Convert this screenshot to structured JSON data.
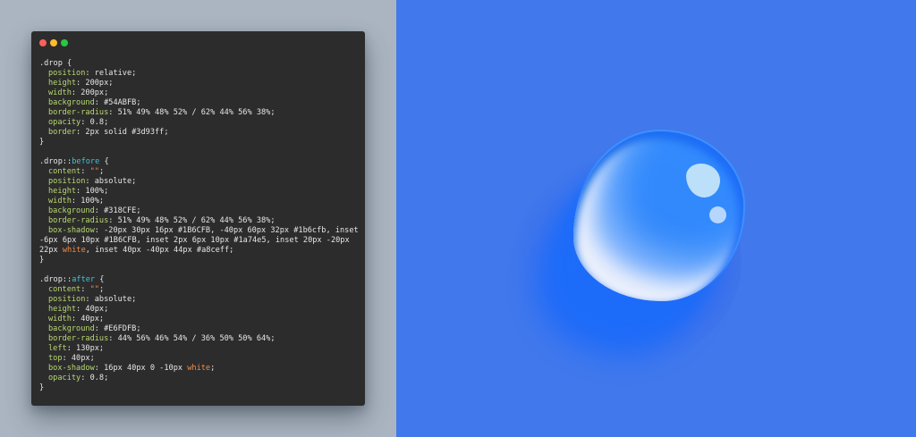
{
  "window": {
    "controls": [
      "close",
      "minimize",
      "zoom"
    ]
  },
  "code": {
    "lines": [
      [
        {
          "t": ".drop {"
        }
      ],
      [
        {
          "ind": 1
        },
        {
          "t": "position",
          "c": "p"
        },
        {
          "t": ": relative;"
        }
      ],
      [
        {
          "ind": 1
        },
        {
          "t": "height",
          "c": "p"
        },
        {
          "t": ": 200px;"
        }
      ],
      [
        {
          "ind": 1
        },
        {
          "t": "width",
          "c": "p"
        },
        {
          "t": ": 200px;"
        }
      ],
      [
        {
          "ind": 1
        },
        {
          "t": "background",
          "c": "p"
        },
        {
          "t": ": #54ABFB;"
        }
      ],
      [
        {
          "ind": 1
        },
        {
          "t": "border-radius",
          "c": "p"
        },
        {
          "t": ": 51% 49% 48% 52% / 62% 44% 56% 38%;"
        }
      ],
      [
        {
          "ind": 1
        },
        {
          "t": "opacity",
          "c": "p"
        },
        {
          "t": ": 0.8;"
        }
      ],
      [
        {
          "ind": 1
        },
        {
          "t": "border",
          "c": "p"
        },
        {
          "t": ": 2px solid #3d93ff;"
        }
      ],
      [
        {
          "t": "}"
        }
      ],
      [],
      [
        {
          "t": ".drop::"
        },
        {
          "t": "before",
          "c": "pe"
        },
        {
          "t": " {"
        }
      ],
      [
        {
          "ind": 1
        },
        {
          "t": "content",
          "c": "p"
        },
        {
          "t": ": "
        },
        {
          "t": "\"\"",
          "c": "kw"
        },
        {
          "t": ";"
        }
      ],
      [
        {
          "ind": 1
        },
        {
          "t": "position",
          "c": "p"
        },
        {
          "t": ": absolute;"
        }
      ],
      [
        {
          "ind": 1
        },
        {
          "t": "height",
          "c": "p"
        },
        {
          "t": ": 100%;"
        }
      ],
      [
        {
          "ind": 1
        },
        {
          "t": "width",
          "c": "p"
        },
        {
          "t": ": 100%;"
        }
      ],
      [
        {
          "ind": 1
        },
        {
          "t": "background",
          "c": "p"
        },
        {
          "t": ": #318CFE;"
        }
      ],
      [
        {
          "ind": 1
        },
        {
          "t": "border-radius",
          "c": "p"
        },
        {
          "t": ": 51% 49% 48% 52% / 62% 44% 56% 38%;"
        }
      ],
      [
        {
          "ind": 1
        },
        {
          "t": "box-shadow",
          "c": "p"
        },
        {
          "t": ": -20px 30px 16px #1B6CFB, -40px 60px 32px #1b6cfb, inset"
        }
      ],
      [
        {
          "t": "-6px 6px 10px #1B6CFB, inset 2px 6px 10px #1a74e5, inset 20px -20px"
        }
      ],
      [
        {
          "t": "22px "
        },
        {
          "t": "white",
          "c": "kw"
        },
        {
          "t": ", inset 40px -40px 44px #a8ceff;"
        }
      ],
      [
        {
          "t": "}"
        }
      ],
      [],
      [
        {
          "t": ".drop::"
        },
        {
          "t": "after",
          "c": "pe"
        },
        {
          "t": " {"
        }
      ],
      [
        {
          "ind": 1
        },
        {
          "t": "content",
          "c": "p"
        },
        {
          "t": ": "
        },
        {
          "t": "\"\"",
          "c": "kw"
        },
        {
          "t": ";"
        }
      ],
      [
        {
          "ind": 1
        },
        {
          "t": "position",
          "c": "p"
        },
        {
          "t": ": absolute;"
        }
      ],
      [
        {
          "ind": 1
        },
        {
          "t": "height",
          "c": "p"
        },
        {
          "t": ": 40px;"
        }
      ],
      [
        {
          "ind": 1
        },
        {
          "t": "width",
          "c": "p"
        },
        {
          "t": ": 40px;"
        }
      ],
      [
        {
          "ind": 1
        },
        {
          "t": "background",
          "c": "p"
        },
        {
          "t": ": #E6FDFB;"
        }
      ],
      [
        {
          "ind": 1
        },
        {
          "t": "border-radius",
          "c": "p"
        },
        {
          "t": ": 44% 56% 46% 54% / 36% 50% 50% 64%;"
        }
      ],
      [
        {
          "ind": 1
        },
        {
          "t": "left",
          "c": "p"
        },
        {
          "t": ": 130px;"
        }
      ],
      [
        {
          "ind": 1
        },
        {
          "t": "top",
          "c": "p"
        },
        {
          "t": ": 40px;"
        }
      ],
      [
        {
          "ind": 1
        },
        {
          "t": "box-shadow",
          "c": "p"
        },
        {
          "t": ": 16px 40px 0 -10px "
        },
        {
          "t": "white",
          "c": "kw"
        },
        {
          "t": ";"
        }
      ],
      [
        {
          "ind": 1
        },
        {
          "t": "opacity",
          "c": "p"
        },
        {
          "t": ": 0.8;"
        }
      ],
      [
        {
          "t": "}"
        }
      ]
    ]
  },
  "colors": {
    "left_background": "#aab5c1",
    "right_background": "#4178ec",
    "editor_background": "#2c2c2d",
    "property_color": "#b9d870",
    "pseudo_color": "#3fc3d6",
    "keyword_color": "#f08d4b"
  }
}
